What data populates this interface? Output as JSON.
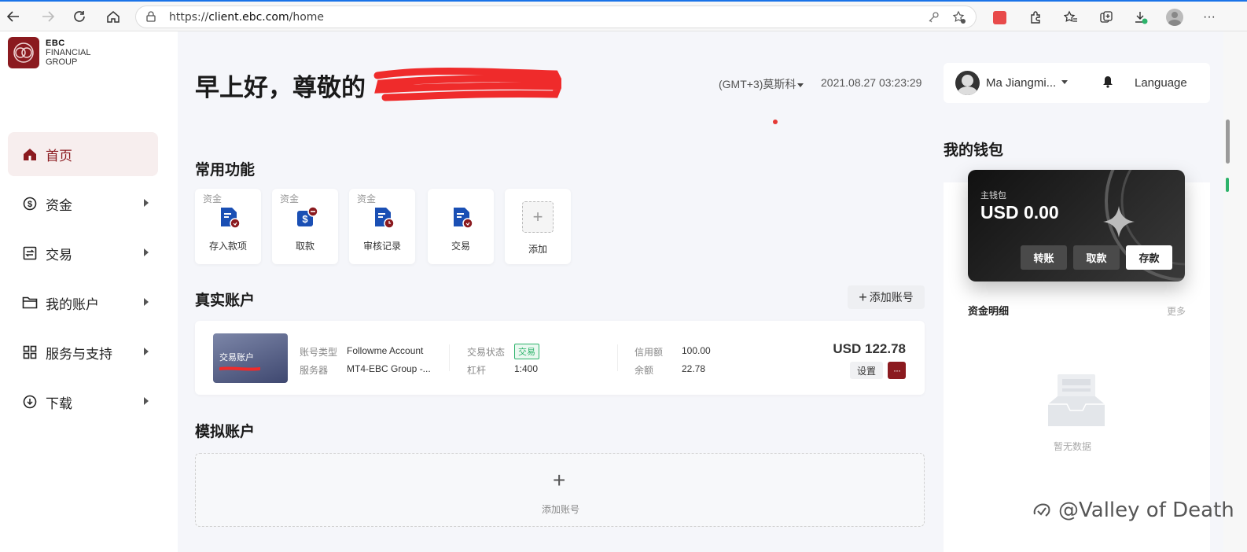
{
  "browser": {
    "url_scheme": "https://",
    "url_host": "client.ebc.com",
    "url_path": "/home"
  },
  "brand": {
    "line1": "EBC",
    "line2": "FINANCIAL",
    "line3": "GROUP",
    "color": "#8b1a1f"
  },
  "sidebar": {
    "items": [
      {
        "label": "首页",
        "icon": "home-icon",
        "active": true
      },
      {
        "label": "资金",
        "icon": "dollar-circle-icon"
      },
      {
        "label": "交易",
        "icon": "trade-icon"
      },
      {
        "label": "我的账户",
        "icon": "folder-icon"
      },
      {
        "label": "服务与支持",
        "icon": "grid-icon"
      },
      {
        "label": "下载",
        "icon": "download-icon"
      }
    ]
  },
  "header": {
    "greeting": "早上好，尊敬的",
    "timezone": "(GMT+3)莫斯科",
    "datetime": "2021.08.27 03:23:29"
  },
  "user": {
    "name": "Ma Jiangmi...",
    "language": "Language"
  },
  "quick": {
    "title": "常用功能",
    "items": [
      {
        "category": "资金",
        "label": "存入款项",
        "icon": "deposit-icon"
      },
      {
        "category": "资金",
        "label": "取款",
        "icon": "withdraw-icon"
      },
      {
        "category": "资金",
        "label": "审核记录",
        "icon": "review-record-icon"
      },
      {
        "category": "",
        "label": "交易",
        "icon": "trade-doc-icon"
      },
      {
        "category": "",
        "label": "添加",
        "icon": "add-icon"
      }
    ]
  },
  "real_accounts": {
    "title": "真实账户",
    "add_label": "添加账号",
    "account": {
      "thumb_label": "交易账户",
      "type_key": "账号类型",
      "type_val": "Followme Account",
      "server_key": "服务器",
      "server_val": "MT4-EBC Group -...",
      "status_key": "交易状态",
      "status_val": "交易",
      "leverage_key": "杠杆",
      "leverage_val": "1:400",
      "credit_key": "信用额",
      "credit_val": "100.00",
      "balance_key": "余额",
      "balance_val": "22.78",
      "equity": "USD 122.78",
      "settings_label": "设置",
      "more_label": "···"
    }
  },
  "demo_accounts": {
    "title": "模拟账户",
    "add_label": "添加账号"
  },
  "wallet": {
    "title": "我的钱包",
    "main_label": "主钱包",
    "amount": "USD 0.00",
    "transfer": "转账",
    "withdraw": "取款",
    "deposit": "存款",
    "fund_detail": "资金明细",
    "more": "更多",
    "empty": "暂无数据"
  },
  "watermark": "@Valley of Death"
}
